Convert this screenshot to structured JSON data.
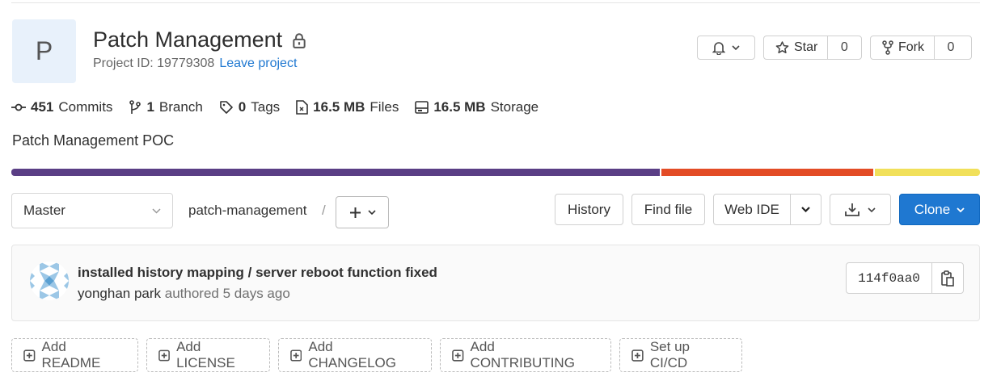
{
  "project": {
    "avatar_letter": "P",
    "title": "Patch Management",
    "id_label": "Project ID: 19779308",
    "leave_link": "Leave project",
    "description": "Patch Management POC"
  },
  "actions": {
    "star_label": "Star",
    "star_count": "0",
    "fork_label": "Fork",
    "fork_count": "0"
  },
  "stats": [
    {
      "value": "451",
      "label": "Commits",
      "icon": "commit-icon"
    },
    {
      "value": "1",
      "label": "Branch",
      "icon": "branch-icon"
    },
    {
      "value": "0",
      "label": "Tags",
      "icon": "tag-icon"
    },
    {
      "value": "16.5 MB",
      "label": "Files",
      "icon": "file-icon"
    },
    {
      "value": "16.5 MB",
      "label": "Storage",
      "icon": "storage-icon"
    }
  ],
  "language_bar": [
    {
      "color": "#5a3e85",
      "share": 0.672
    },
    {
      "color": "#e34c26",
      "share": 0.219
    },
    {
      "color": "#f1e05a",
      "share": 0.109
    }
  ],
  "repo": {
    "branch": "Master",
    "path": "patch-management",
    "separator": "/",
    "history": "History",
    "find_file": "Find file",
    "web_ide": "Web IDE",
    "clone": "Clone"
  },
  "last_commit": {
    "message": "installed history mapping / server reboot function fixed",
    "author": "yonghan park",
    "authored": "authored 5 days ago",
    "sha": "114f0aa0"
  },
  "quick_actions": [
    "Add README",
    "Add LICENSE",
    "Add CHANGELOG",
    "Add CONTRIBUTING",
    "Set up CI/CD"
  ],
  "colors": {
    "accent": "#1f78d1",
    "link": "#1f78d1"
  }
}
